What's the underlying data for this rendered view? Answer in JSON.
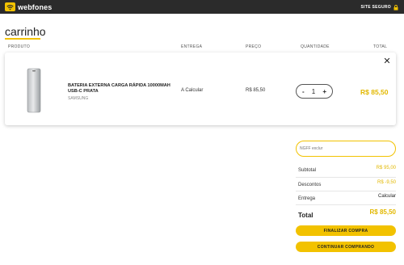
{
  "header": {
    "logo_text": "webfones",
    "secure_label": "SITE SEGURO"
  },
  "page": {
    "title": "carrinho"
  },
  "columns": {
    "product": "PRODUTO",
    "delivery": "ENTREGA",
    "price": "PREÇO",
    "quantity": "QUANTIDADE",
    "total": "TOTAL"
  },
  "cart_item": {
    "name": "BATERIA EXTERNA CARGA RÁPIDA 10000MAH USB-C PRATA",
    "brand": "SAMSUNG",
    "delivery": "A Calcular",
    "unit_price": "R$ 85,50",
    "quantity": "1",
    "minus": "-",
    "plus": "+",
    "total": "R$ 85,50",
    "close_glyph": "✕"
  },
  "coupon": {
    "placeholder": "NGFF exclur"
  },
  "summary": {
    "subtotal_label": "Subtotal",
    "subtotal_value": "R$ 95,00",
    "discount_label": "Descontos",
    "discount_value": "R$ -9,50",
    "delivery_label": "Entrega",
    "delivery_value": "Calcular",
    "total_label": "Total",
    "total_value": "R$ 85,50"
  },
  "actions": {
    "checkout": "FINALIZAR COMPRA",
    "continue": "CONTINUAR COMPRANDO"
  },
  "colors": {
    "accent": "#f2c200",
    "price_accent": "#e2b800",
    "topbar": "#2b2b2b"
  }
}
